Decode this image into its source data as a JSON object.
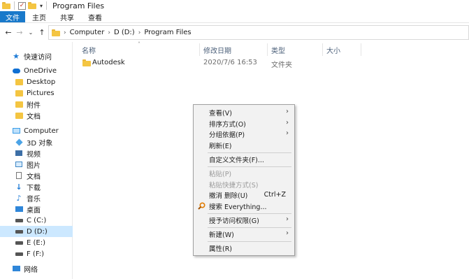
{
  "window": {
    "title": "Program Files",
    "quick_access_arrow": "▾",
    "check_mark": "✓"
  },
  "ribbon": {
    "tabs": [
      "文件",
      "主页",
      "共享",
      "查看"
    ]
  },
  "nav": {
    "back": "←",
    "forward": "→",
    "recent": "⌄",
    "up": "↑",
    "crumb_sep": "›",
    "breadcrumb": [
      "Computer",
      "D (D:)",
      "Program Files"
    ]
  },
  "sidebar": {
    "items": [
      {
        "label": "快速访问",
        "icon": "star-icon"
      },
      {
        "label": "OneDrive",
        "icon": "cloud-icon"
      },
      {
        "label": "Desktop",
        "icon": "folder-icon"
      },
      {
        "label": "Pictures",
        "icon": "folder-icon"
      },
      {
        "label": "附件",
        "icon": "folder-icon"
      },
      {
        "label": "文档",
        "icon": "folder-icon"
      },
      {
        "label": "Computer",
        "icon": "computer-icon"
      },
      {
        "label": "3D 对象",
        "icon": "cube-icon"
      },
      {
        "label": "视频",
        "icon": "video-icon"
      },
      {
        "label": "图片",
        "icon": "picture-icon"
      },
      {
        "label": "文档",
        "icon": "document-icon"
      },
      {
        "label": "下载",
        "icon": "download-icon"
      },
      {
        "label": "音乐",
        "icon": "music-icon"
      },
      {
        "label": "桌面",
        "icon": "desktop-icon"
      },
      {
        "label": "C (C:)",
        "icon": "drive-icon"
      },
      {
        "label": "D (D:)",
        "icon": "drive-icon",
        "selected": true
      },
      {
        "label": "E (E:)",
        "icon": "drive-icon"
      },
      {
        "label": "F (F:)",
        "icon": "drive-icon"
      },
      {
        "label": "网络",
        "icon": "network-icon"
      }
    ],
    "star_glyph": "★",
    "download_glyph": "↓",
    "music_glyph": "♪"
  },
  "columns": {
    "name": "名称",
    "modified": "修改日期",
    "type": "类型",
    "size": "大小",
    "sort_glyph": "˄"
  },
  "files": [
    {
      "name": "Autodesk",
      "modified": "2020/7/6 16:53",
      "type": "文件夹",
      "size": ""
    }
  ],
  "context_menu": {
    "sub_glyph": "›",
    "items": [
      {
        "label": "查看(V)",
        "submenu": true
      },
      {
        "label": "排序方式(O)",
        "submenu": true
      },
      {
        "label": "分组依据(P)",
        "submenu": true
      },
      {
        "label": "刷新(E)"
      },
      {
        "label": "自定义文件夹(F)..."
      },
      {
        "label": "粘贴(P)",
        "disabled": true
      },
      {
        "label": "粘贴快捷方式(S)",
        "disabled": true
      },
      {
        "label": "撤消 删除(U)",
        "shortcut": "Ctrl+Z"
      },
      {
        "label": "搜索 Everything...",
        "icon": "everything-search-icon"
      },
      {
        "label": "授予访问权限(G)",
        "submenu": true
      },
      {
        "label": "新建(W)",
        "submenu": true
      },
      {
        "label": "属性(R)"
      }
    ]
  },
  "colors": {
    "file_tab": "#1979ca",
    "selection": "#cce8ff",
    "folder": "#f4c542",
    "menu_bg": "#f2f2f2"
  }
}
